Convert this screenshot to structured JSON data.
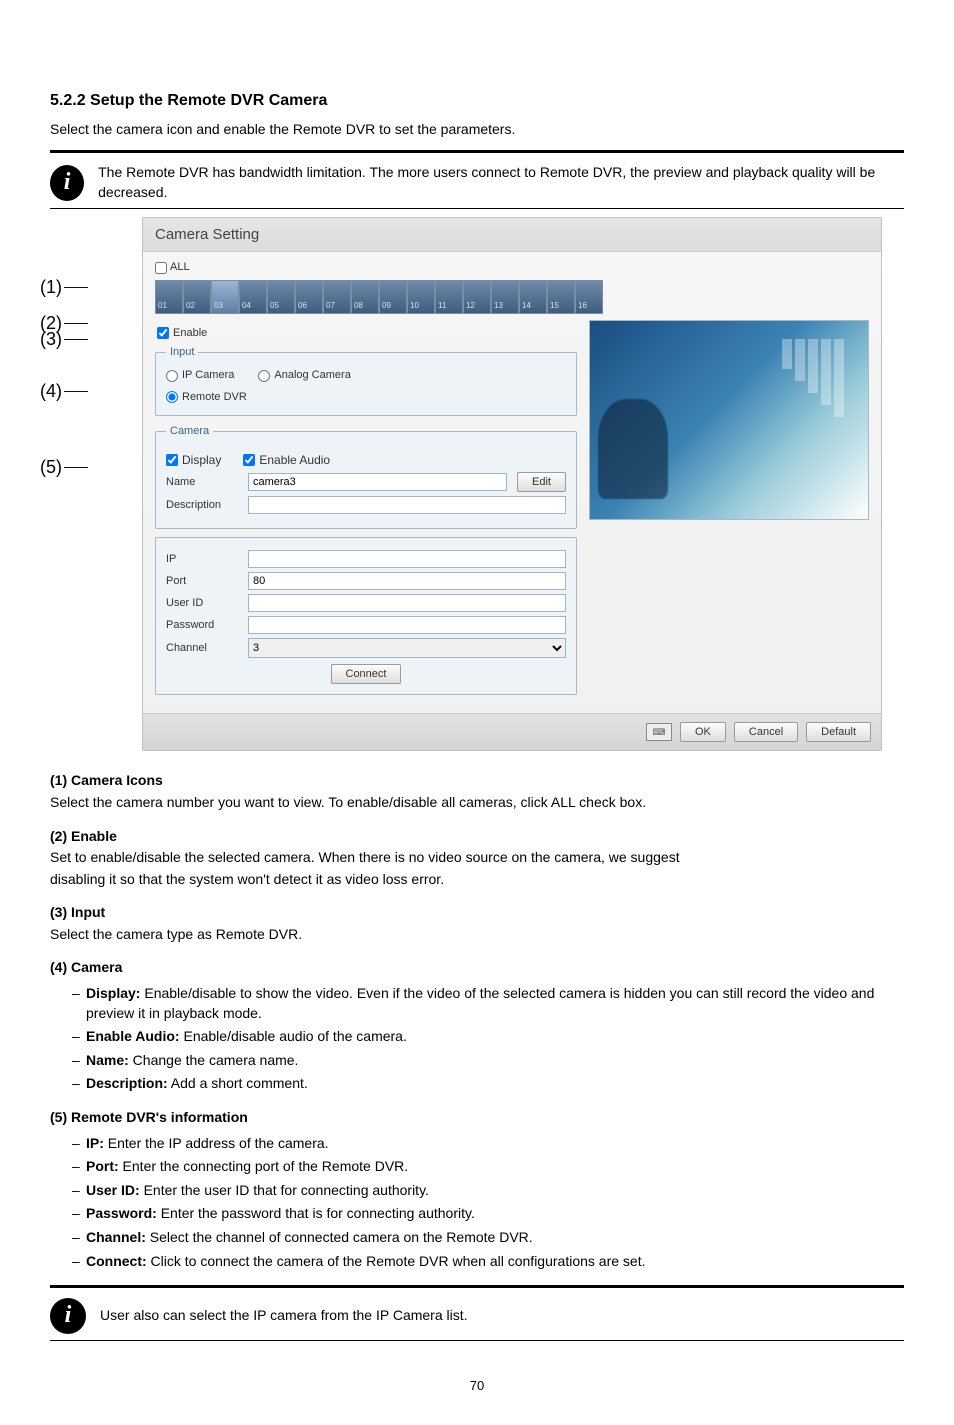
{
  "section": {
    "heading": "5.2.2 Setup the Remote DVR Camera",
    "intro": "Select the camera icon and enable the Remote DVR to set the parameters.",
    "note_after_rules": "The Remote DVR has bandwidth limitation. The more users connect to Remote DVR, the preview and playback quality will be decreased."
  },
  "callouts": {
    "c1": "(1)",
    "c2": "(2)",
    "c3": "(3)",
    "c4": "(4)",
    "c5": "(5)"
  },
  "dialog": {
    "title": "Camera Setting",
    "all_checkbox": "ALL",
    "camera_numbers": [
      "01",
      "02",
      "03",
      "04",
      "05",
      "06",
      "07",
      "08",
      "09",
      "10",
      "11",
      "12",
      "13",
      "14",
      "15",
      "16"
    ],
    "enable_label": "Enable",
    "groups": {
      "input": {
        "legend": "Input",
        "ip_camera": "IP Camera",
        "analog_camera": "Analog Camera",
        "remote_dvr": "Remote DVR"
      },
      "camera": {
        "legend": "Camera",
        "display": "Display",
        "enable_audio": "Enable Audio",
        "name_label": "Name",
        "name_value": "camera3",
        "edit": "Edit",
        "description_label": "Description",
        "description_value": ""
      }
    },
    "fields": {
      "ip_label": "IP",
      "ip_value": "",
      "port_label": "Port",
      "port_value": "80",
      "user_label": "User ID",
      "user_value": "",
      "password_label": "Password",
      "password_value": "",
      "channel_label": "Channel",
      "channel_value": "3"
    },
    "connect": "Connect",
    "footer": {
      "ok": "OK",
      "cancel": "Cancel",
      "default": "Default"
    }
  },
  "defs": {
    "d1": {
      "head": "(1) Camera Icons",
      "body": "Select the camera number you want to view. To enable/disable all cameras, click ALL check box."
    },
    "d2": {
      "head": "(2) Enable",
      "body_prefix": "Set to enable/disable the selected camera. When there is no video source on the camera, we suggest",
      "body_suffix": "disabling it so that the system won't detect it as video loss error."
    },
    "d3": {
      "head": "(3) Input",
      "body": "Select the camera type as Remote DVR."
    },
    "d4": {
      "head": "(4) Camera",
      "bullets": {
        "display": {
          "label": "Display:",
          "text": " Enable/disable to show the video. Even if the video of the selected camera is hidden you can still record the video and preview it in playback mode."
        },
        "enable_audio": {
          "label": "Enable Audio:",
          "text": " Enable/disable audio of the camera."
        },
        "name": {
          "label": "Name:",
          "text": " Change the camera name."
        },
        "description": {
          "label": "Description:",
          "text": " Add a short comment."
        }
      }
    },
    "d5": {
      "head": "(5) Remote DVR's information",
      "bullets": {
        "ip": {
          "label": "IP:",
          "text": " Enter the IP address of the camera."
        },
        "port": {
          "label": "Port:",
          "text": " Enter the connecting port of the Remote DVR."
        },
        "user": {
          "label": "User ID:",
          "text": " Enter the user ID that for connecting authority."
        },
        "password": {
          "label": "Password:",
          "text": " Enter the password that is for connecting authority."
        },
        "channel": {
          "label": "Channel:",
          "text": " Select the channel of connected camera on the Remote DVR."
        },
        "connect": {
          "label": "Connect:",
          "text": " Click to connect the camera of the Remote DVR when all configurations are set."
        }
      }
    }
  },
  "note2": "User also can select the IP camera from the IP Camera list.",
  "page_number": "70"
}
